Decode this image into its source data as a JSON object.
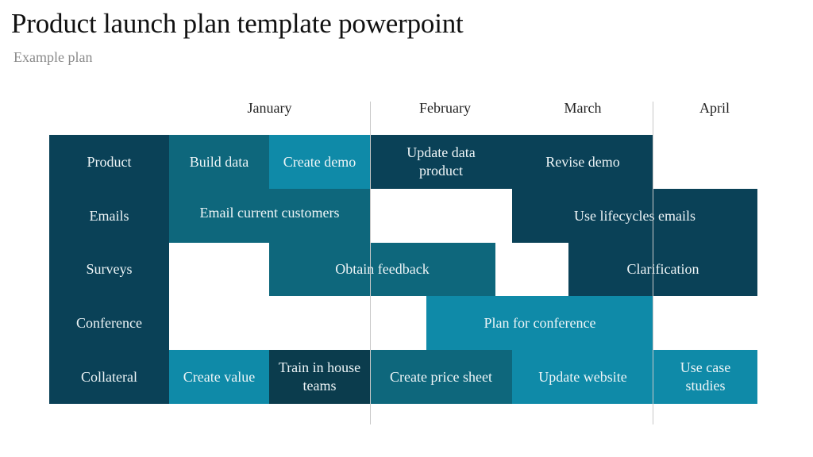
{
  "header": {
    "title": "Product launch plan template powerpoint",
    "subtitle": "Example plan"
  },
  "colors": {
    "dark": "#0a4157",
    "mid": "#0e677c",
    "light": "#0f8aa8",
    "darkest": "#0b3c4d",
    "divider": "#c8c8c8"
  },
  "months": [
    "January",
    "February",
    "March",
    "April"
  ],
  "rows": [
    {
      "label": "Product"
    },
    {
      "label": "Emails"
    },
    {
      "label": "Surveys"
    },
    {
      "label": "Conference"
    },
    {
      "label": "Collateral"
    }
  ],
  "tasks": [
    {
      "row": "Product",
      "label": "Build data",
      "color": "mid"
    },
    {
      "row": "Product",
      "label": "Create demo",
      "color": "light"
    },
    {
      "row": "Product",
      "label": "Update data product",
      "color": "dark"
    },
    {
      "row": "Product",
      "label": "Revise demo",
      "color": "dark"
    },
    {
      "row": "Emails",
      "label": "Email current customers",
      "color": "mid"
    },
    {
      "row": "Emails",
      "label": "Use lifecycles emails",
      "color": "dark"
    },
    {
      "row": "Surveys",
      "label": "Obtain feedback",
      "color": "mid"
    },
    {
      "row": "Surveys",
      "label": "Clarification",
      "color": "dark"
    },
    {
      "row": "Conference",
      "label": "Plan for conference",
      "color": "light"
    },
    {
      "row": "Collateral",
      "label": "Create value",
      "color": "light"
    },
    {
      "row": "Collateral",
      "label": "Train in house teams",
      "color": "darkest"
    },
    {
      "row": "Collateral",
      "label": "Create price sheet",
      "color": "mid"
    },
    {
      "row": "Collateral",
      "label": "Update website",
      "color": "light"
    },
    {
      "row": "Collateral",
      "label": "Use case studies",
      "color": "light"
    }
  ]
}
